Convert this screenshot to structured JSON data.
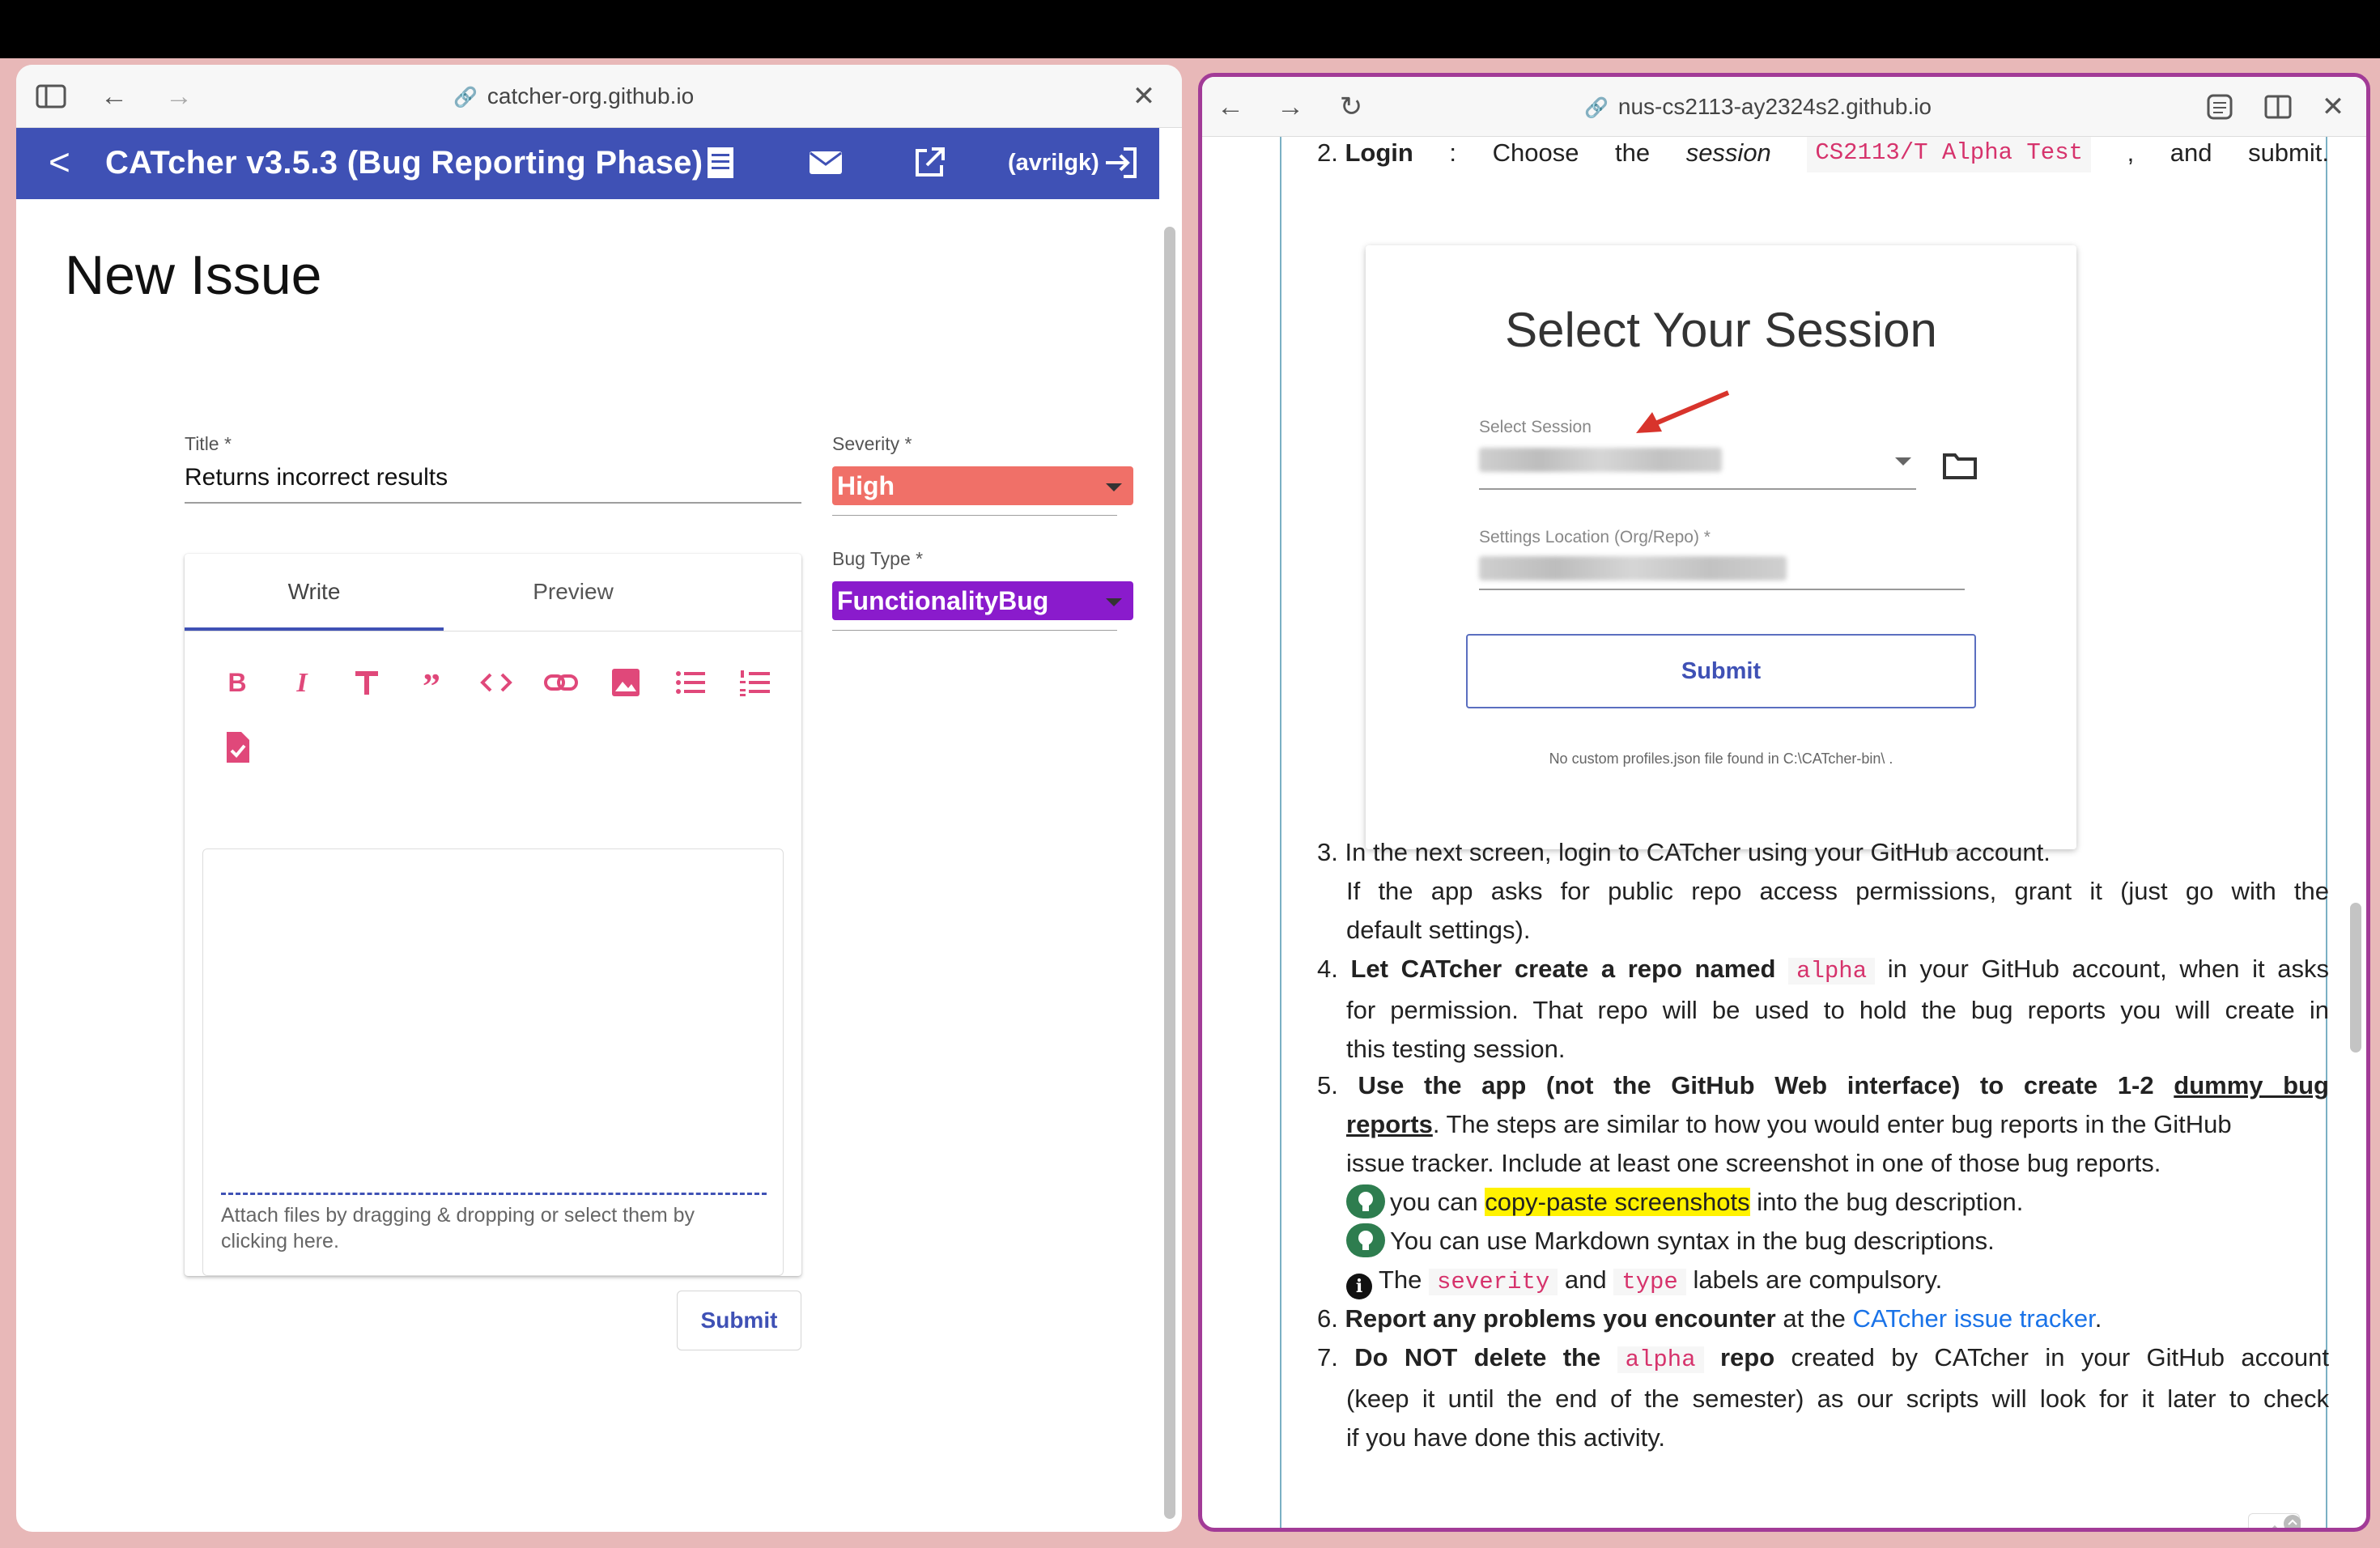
{
  "left_window": {
    "url": "catcher-org.github.io",
    "app": {
      "title": "CATcher v3.5.3  (Bug Reporting Phase)",
      "user": "(avrilgk)",
      "page_heading": "New Issue",
      "form": {
        "title_label": "Title *",
        "title_value": "Returns incorrect results",
        "severity_label": "Severity *",
        "severity_value": "High",
        "bugtype_label": "Bug Type *",
        "bugtype_value": "FunctionalityBug",
        "tabs": [
          "Write",
          "Preview"
        ],
        "attach_hint": "Attach files by dragging & dropping or select them by clicking here.",
        "submit_label": "Submit"
      },
      "colors": {
        "appbar": "#3f51b5",
        "severity": "#f07068",
        "bugtype": "#8a1bcc",
        "toolbar_icons": "#e0487a"
      }
    }
  },
  "right_window": {
    "url": "nus-cs2113-ay2324s2.github.io",
    "steps": {
      "s2": {
        "num": "2.",
        "bold": "Login",
        "t1": ":  Choose  the ",
        "em": "session",
        "code": "CS2113/T Alpha Test",
        "t2": ", and submit."
      },
      "screenshot": {
        "title": "Select Your Session",
        "session_label": "Select Session",
        "settings_label": "Settings Location (Org/Repo) *",
        "submit": "Submit",
        "note": "No custom profiles.json file found in C:\\CATcher-bin\\ ."
      },
      "s3": {
        "num": "3.",
        "line1": "In the next screen, login to CATcher using your GitHub account.",
        "line2": "If the app asks for public repo access permissions, grant it (just go with the",
        "line3": "default settings)."
      },
      "s4": {
        "num": "4.",
        "bold": "Let CATcher create a repo named",
        "code": "alpha",
        "t1": " in your GitHub account, when it asks",
        "line2": "for permission. That repo will be used to hold the bug reports you will create in",
        "line3": "this testing session."
      },
      "s5": {
        "num": "5.",
        "bold1": "Use the app (not the GitHub Web interface) to create 1-2",
        "u1": "dummy bug",
        "u2": "reports",
        "t1": ". The steps are similar to how you would enter bug reports in the GitHub",
        "line3": "issue tracker. Include at least one screenshot in one of those bug reports.",
        "tip1_a": "you can ",
        "tip1_hl": "copy-paste screenshots",
        "tip1_b": " into the bug description.",
        "tip2": "You can use Markdown syntax in the bug descriptions.",
        "info_a": "The ",
        "info_code1": "severity",
        "info_b": " and ",
        "info_code2": "type",
        "info_c": " labels are compulsory."
      },
      "s6": {
        "num": "6.",
        "bold": "Report any problems you encounter",
        "t1": " at the ",
        "link": "CATcher issue tracker",
        "t2": "."
      },
      "s7": {
        "num": "7.",
        "bold1": "Do NOT delete the",
        "code": "alpha",
        "bold2": "repo",
        "t1": " created by CATcher in your GitHub account",
        "line2": "(keep it until the end of the semester) as our scripts will look for it later to check",
        "line3": "if you have done this activity."
      }
    }
  }
}
